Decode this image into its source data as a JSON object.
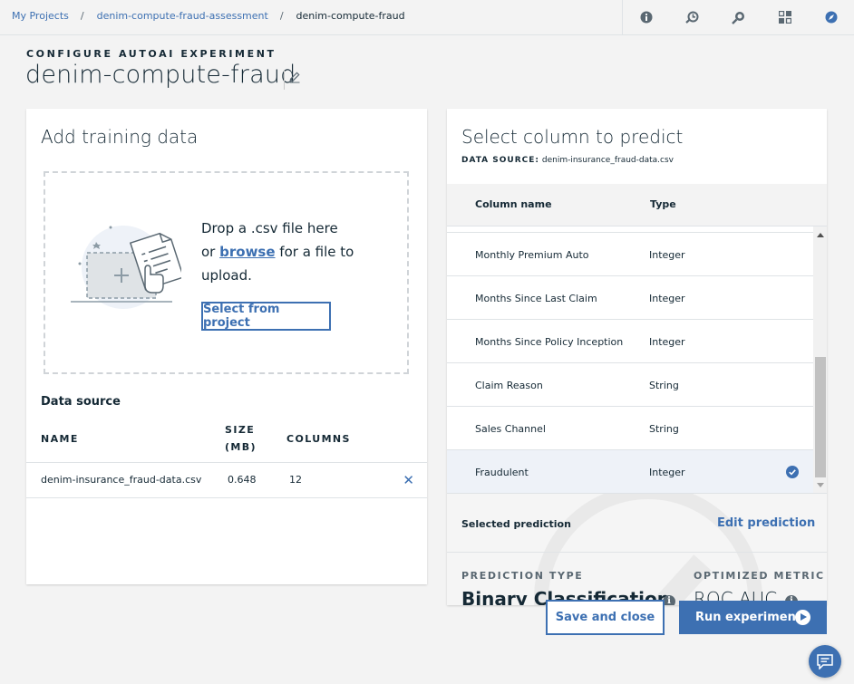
{
  "breadcrumb": {
    "items": [
      "My Projects",
      "denim-compute-fraud-assessment"
    ],
    "separator": "/",
    "current": "denim-compute-fraud"
  },
  "toolbar": {
    "icons": [
      "info-icon",
      "history-icon",
      "search-icon",
      "grid-icon",
      "compass-icon"
    ]
  },
  "header": {
    "eyebrow": "CONFIGURE AUTOAI EXPERIMENT",
    "title": "denim-compute-fraud"
  },
  "training": {
    "title": "Add training data",
    "drop_text_1": "Drop a .csv file here",
    "drop_text_2_prefix": "or ",
    "browse_link": "browse",
    "drop_text_2_suffix": " for a file to upload.",
    "select_button": "Select from project",
    "data_source_heading": "Data source",
    "table": {
      "col_name": "NAME",
      "col_size": "SIZE (MB)",
      "col_columns": "COLUMNS",
      "row": {
        "name": "denim-insurance_fraud-data.csv",
        "size": "0.648",
        "columns": "12"
      }
    }
  },
  "predict": {
    "title": "Select column to predict",
    "data_source_label": "DATA SOURCE:",
    "data_source_value": "denim-insurance_fraud-data.csv",
    "header_name": "Column name",
    "header_type": "Type",
    "rows": [
      {
        "name": "Monthly Premium Auto",
        "type": "Integer"
      },
      {
        "name": "Months Since Last Claim",
        "type": "Integer"
      },
      {
        "name": "Months Since Policy Inception",
        "type": "Integer"
      },
      {
        "name": "Claim Reason",
        "type": "String"
      },
      {
        "name": "Sales Channel",
        "type": "String"
      },
      {
        "name": "Fraudulent",
        "type": "Integer"
      }
    ],
    "selected_prediction_label": "Selected prediction",
    "edit_prediction": "Edit prediction",
    "prediction_type_label": "PREDICTION TYPE",
    "prediction_type_value": "Binary Classification",
    "optimized_metric_label": "OPTIMIZED METRIC",
    "optimized_metric_value": "ROC AUC"
  },
  "actions": {
    "save_close": "Save and close",
    "run": "Run experiment"
  },
  "colors": {
    "accent": "#3d70b2",
    "text": "#152935",
    "background": "#f3f3f3"
  }
}
